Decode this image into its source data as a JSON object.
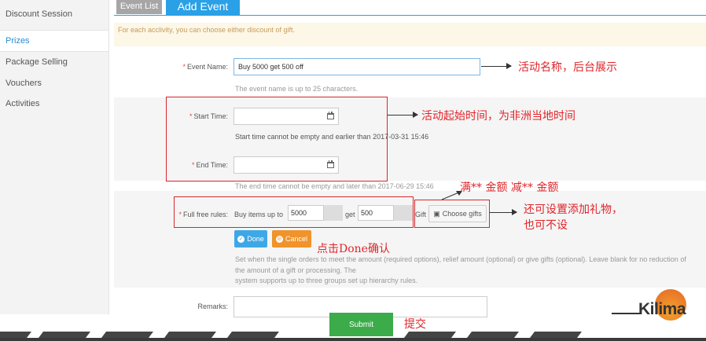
{
  "sidebar": {
    "items": [
      {
        "label": "Discount Session"
      },
      {
        "label": "Prizes"
      },
      {
        "label": "Package Selling"
      },
      {
        "label": "Vouchers"
      },
      {
        "label": "Activities"
      }
    ]
  },
  "tabs": {
    "list_label": "Event List",
    "add_label": "Add Event"
  },
  "notice": "For each acclivity, you can choose either discount of gift.",
  "form": {
    "event_name": {
      "label": "Event Name:",
      "value": "Buy 5000 get 500 off",
      "hint": "The event name is up to 25 characters."
    },
    "start_time": {
      "label": "Start Time:",
      "value": "",
      "hint": "Start time cannot be empty and earlier than 2017-03-31 15:46"
    },
    "end_time": {
      "label": "End Time:",
      "value": "",
      "hint": "The end time cannot be empty and later than 2017-06-29 15:46"
    },
    "full_free": {
      "label": "Full free rules:",
      "buy_text": "Buy items up to",
      "buy_value": "5000",
      "get_text": "get",
      "get_value": "500",
      "gift_text": "Gift",
      "choose_label": "Choose gifts"
    },
    "done_label": "Done",
    "cancel_label": "Cancel",
    "rules_hint_1": "Set when the single orders to meet the amount (required options), relief amount (optional) or give gifts (optional). Leave blank for no reduction of",
    "rules_hint_2": "the amount of a gift or processing. The",
    "rules_hint_3": "system supports up to three groups set up hierarchy rules.",
    "remarks_label": "Remarks:",
    "submit_label": "Submit",
    "required_mark": "*"
  },
  "annotations": {
    "event_name": "活动名称，后台展示",
    "time": "活动起始时间，为非洲当地时间",
    "full_reduce": "满** 金额 减** 金额",
    "gift_1": "还可设置添加礼物，",
    "gift_2": "也可不设",
    "done": "点击Done确认",
    "submit": "提交"
  },
  "logo": {
    "text": "Kilima"
  },
  "colors": {
    "accent": "#2aa0e6",
    "annotation": "#e0242a",
    "submit": "#3cab4a",
    "cancel": "#f0932b"
  }
}
